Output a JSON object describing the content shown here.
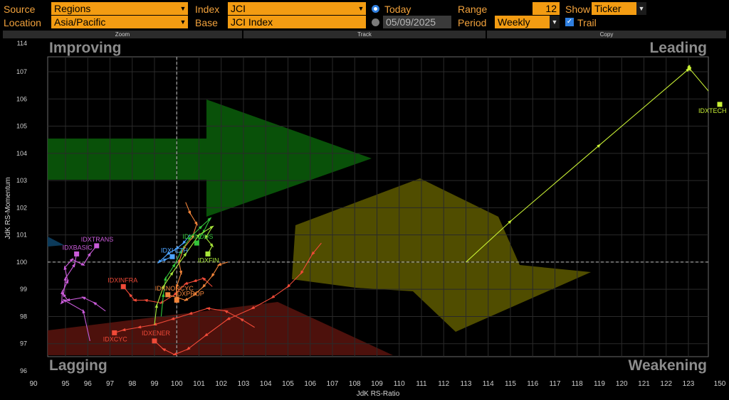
{
  "toolbar": {
    "source_label": "Source",
    "source_value": "Regions",
    "location_label": "Location",
    "location_value": "Asia/Pacific",
    "index_label": "Index",
    "index_value": "JCI",
    "base_label": "Base",
    "base_value": "JCI Index",
    "today_label": "Today",
    "date_value": "05/09/2025",
    "range_label": "Range",
    "range_value": "12",
    "period_label": "Period",
    "period_value": "Weekly",
    "show_label": "Show",
    "show_value": "Ticker",
    "trail_label": "Trail",
    "zoom_label": "Zoom",
    "track_label": "Track",
    "copy_label": "Copy"
  },
  "colors": {
    "accent": "#f39c12",
    "improving": "#0a5f0a",
    "weakening": "#5e5a00",
    "lagging": "#5a140e"
  },
  "chart_data": {
    "type": "scatter",
    "xlabel": "JdK RS-Ratio",
    "ylabel": "JdK RS-Momentum",
    "quadrants": {
      "top_left": "Improving",
      "top_right": "Leading",
      "bottom_left": "Lagging",
      "bottom_right": "Weakening"
    },
    "x_ticks": [
      "90",
      "95",
      "96",
      "97",
      "98",
      "99",
      "100",
      "101",
      "102",
      "103",
      "104",
      "105",
      "106",
      "107",
      "108",
      "109",
      "110",
      "111",
      "112",
      "113",
      "114",
      "115",
      "116",
      "117",
      "118",
      "119",
      "120",
      "121",
      "122",
      "123",
      "150"
    ],
    "y_ticks": [
      "96",
      "97",
      "98",
      "99",
      "100",
      "101",
      "102",
      "103",
      "104",
      "105",
      "106",
      "107",
      "114"
    ],
    "series": [
      {
        "name": "IDXTECH",
        "color": "#c9f135",
        "last": [
          150,
          105.8
        ],
        "trail": [
          [
            113,
            100
          ],
          [
            115,
            101.5
          ],
          [
            119,
            104.3
          ],
          [
            123,
            107.6
          ],
          [
            123.4,
            107.9
          ],
          [
            123.8,
            108.2
          ],
          [
            124.2,
            108.1
          ],
          [
            124.5,
            107.6
          ],
          [
            150,
            105.8
          ]
        ]
      },
      {
        "name": "IDXTRANS",
        "color": "#c95bd9",
        "last": [
          96.4,
          100.6
        ],
        "trail": [
          [
            96.1,
            97.1
          ],
          [
            95.8,
            98.2
          ],
          [
            94.8,
            98.6
          ],
          [
            94.4,
            98.5
          ],
          [
            94.5,
            98.9
          ],
          [
            95.1,
            99.3
          ],
          [
            94.9,
            99.8
          ],
          [
            95.3,
            100.1
          ],
          [
            95.8,
            99.9
          ],
          [
            96.1,
            100.3
          ],
          [
            96.4,
            100.6
          ]
        ]
      },
      {
        "name": "IDXBASIC",
        "color": "#c95bd9",
        "last": [
          95.5,
          100.3
        ],
        "trail": [
          [
            96.8,
            98.2
          ],
          [
            96.3,
            98.5
          ],
          [
            95.8,
            98.7
          ],
          [
            95.1,
            98.6
          ],
          [
            94.7,
            98.8
          ],
          [
            95.0,
            99.4
          ],
          [
            95.4,
            99.9
          ],
          [
            95.5,
            100.3
          ]
        ]
      },
      {
        "name": "IDXINFRA",
        "color": "#f04a38",
        "last": [
          97.6,
          99.1
        ],
        "trail": [
          [
            101.6,
            99.1
          ],
          [
            101.2,
            99.4
          ],
          [
            100.8,
            99.3
          ],
          [
            100.4,
            99.2
          ],
          [
            99.9,
            98.8
          ],
          [
            99.3,
            98.5
          ],
          [
            98.6,
            98.6
          ],
          [
            98.1,
            98.6
          ],
          [
            97.9,
            98.8
          ],
          [
            97.6,
            99.1
          ]
        ]
      },
      {
        "name": "IDXCYC",
        "color": "#f04a38",
        "last": [
          97.2,
          97.4
        ],
        "trail": [
          [
            103.5,
            97.6
          ],
          [
            102.9,
            97.9
          ],
          [
            102.2,
            98.2
          ],
          [
            101.4,
            98.3
          ],
          [
            100.6,
            98.1
          ],
          [
            99.8,
            97.9
          ],
          [
            99.0,
            97.7
          ],
          [
            98.3,
            97.6
          ],
          [
            97.6,
            97.5
          ],
          [
            97.2,
            97.4
          ]
        ]
      },
      {
        "name": "IDXENER",
        "color": "#f04a38",
        "last": [
          99.0,
          97.1
        ],
        "trail": [
          [
            106.5,
            100.7
          ],
          [
            106.1,
            100.3
          ],
          [
            105.6,
            99.6
          ],
          [
            105.0,
            99.1
          ],
          [
            104.3,
            98.7
          ],
          [
            103.4,
            98.3
          ],
          [
            102.3,
            97.9
          ],
          [
            101.3,
            97.3
          ],
          [
            100.5,
            96.8
          ],
          [
            99.9,
            96.6
          ],
          [
            99.4,
            96.8
          ],
          [
            99.0,
            97.1
          ]
        ]
      },
      {
        "name": "IDXNONCYC",
        "color": "#f2843a",
        "last": [
          99.6,
          98.8
        ],
        "trail": [
          [
            102.3,
            100.0
          ],
          [
            101.9,
            99.9
          ],
          [
            101.6,
            99.5
          ],
          [
            101.2,
            99.1
          ],
          [
            100.8,
            98.8
          ],
          [
            100.4,
            98.6
          ],
          [
            100.0,
            98.7
          ],
          [
            99.6,
            98.8
          ]
        ]
      },
      {
        "name": "IDXPROP",
        "color": "#f2843a",
        "last": [
          100.0,
          98.6
        ],
        "trail": [
          [
            100.4,
            102.2
          ],
          [
            100.6,
            101.8
          ],
          [
            100.9,
            101.4
          ],
          [
            100.7,
            100.9
          ],
          [
            100.3,
            100.5
          ],
          [
            100.1,
            100.0
          ],
          [
            100.2,
            99.6
          ],
          [
            100.0,
            99.1
          ],
          [
            100.0,
            98.6
          ]
        ]
      },
      {
        "name": "IDXHLTH",
        "color": "#4da3ff",
        "last": [
          99.8,
          100.2
        ],
        "trail": [
          [
            100.6,
            101.0
          ],
          [
            100.3,
            100.7
          ],
          [
            100.0,
            100.5
          ],
          [
            99.6,
            100.3
          ],
          [
            99.2,
            100.0
          ],
          [
            99.5,
            100.1
          ],
          [
            99.8,
            100.2
          ]
        ]
      },
      {
        "name": "IDXINDUS",
        "color": "#33c43a",
        "last": [
          100.9,
          100.7
        ],
        "trail": [
          [
            99.3,
            98.0
          ],
          [
            99.4,
            98.8
          ],
          [
            99.5,
            99.4
          ],
          [
            99.9,
            99.9
          ],
          [
            100.2,
            100.4
          ],
          [
            100.6,
            100.9
          ],
          [
            101.1,
            101.3
          ],
          [
            101.5,
            101.6
          ],
          [
            101.2,
            101.1
          ],
          [
            100.9,
            100.7
          ]
        ]
      },
      {
        "name": "IDXFIN",
        "color": "#a8e63a",
        "last": [
          101.4,
          100.3
        ],
        "trail": [
          [
            99.0,
            97.7
          ],
          [
            99.1,
            98.4
          ],
          [
            99.4,
            99.1
          ],
          [
            99.8,
            99.6
          ],
          [
            100.4,
            100.3
          ],
          [
            101.0,
            101.0
          ],
          [
            101.6,
            101.3
          ],
          [
            101.3,
            100.9
          ],
          [
            101.6,
            100.6
          ],
          [
            101.4,
            100.3
          ]
        ]
      }
    ]
  }
}
